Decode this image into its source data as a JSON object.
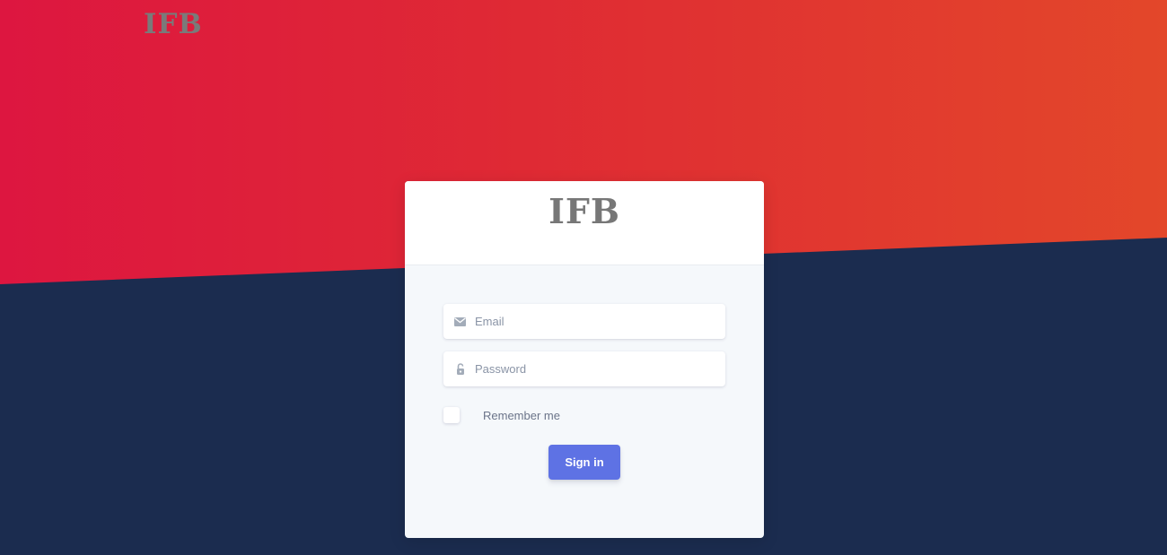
{
  "brand": {
    "logo_text": "IFB"
  },
  "login_card": {
    "logo_text": "IFB",
    "email": {
      "placeholder": "Email",
      "icon": "envelope-icon",
      "value": ""
    },
    "password": {
      "placeholder": "Password",
      "icon": "lock-icon",
      "value": ""
    },
    "remember": {
      "label": "Remember me",
      "checked": false
    },
    "submit_label": "Sign in"
  },
  "colors": {
    "hero_gradient_start": "#dd1640",
    "hero_gradient_end": "#e3472a",
    "background": "#1b2c4f",
    "primary_button": "#5e72e4",
    "logo_gray": "#777777"
  }
}
